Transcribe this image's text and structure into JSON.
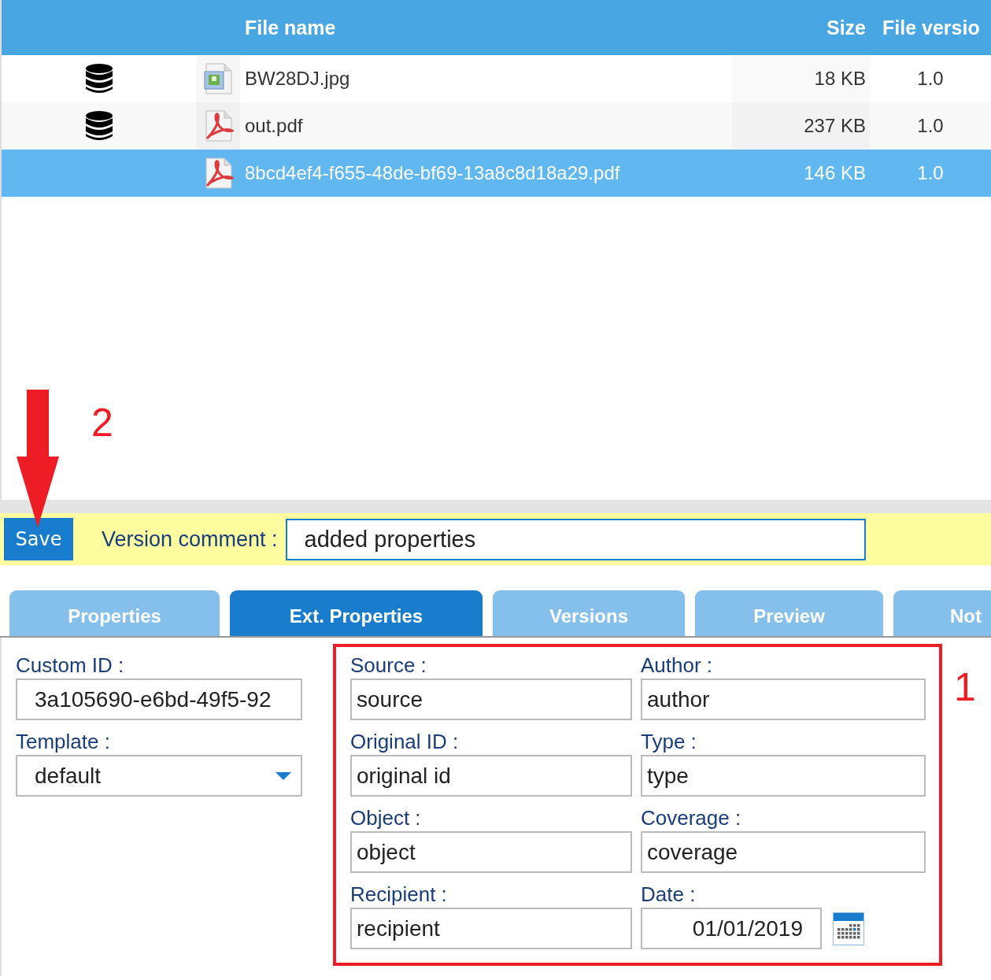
{
  "table": {
    "columns": [
      {
        "label": "File name"
      },
      {
        "label": "Size"
      },
      {
        "label": "File versio"
      }
    ],
    "rows": [
      {
        "stored": true,
        "kind": "image",
        "name": "BW28DJ.jpg",
        "size": "18 KB",
        "version": "1.0",
        "selected": false
      },
      {
        "stored": true,
        "kind": "pdf",
        "name": "out.pdf",
        "size": "237 KB",
        "version": "1.0",
        "selected": false
      },
      {
        "stored": false,
        "kind": "pdf",
        "name": "8bcd4ef4-f655-48de-bf69-13a8c8d18a29.pdf",
        "size": "146 KB",
        "version": "1.0",
        "selected": true
      }
    ]
  },
  "comment_bar": {
    "button": "Save",
    "label": "Version comment :",
    "value": "added properties"
  },
  "tabs": [
    {
      "label": "Properties",
      "selected": false
    },
    {
      "label": "Ext. Properties",
      "selected": true
    },
    {
      "label": "Versions",
      "selected": false
    },
    {
      "label": "Preview",
      "selected": false
    },
    {
      "label": "Not",
      "selected": false
    }
  ],
  "left_fields": [
    {
      "kind": "text",
      "label": "Custom ID :",
      "value": "3a105690-e6bd-49f5-92"
    },
    {
      "kind": "select",
      "label": "Template :",
      "value": "default"
    }
  ],
  "ext_fields": [
    {
      "kind": "text",
      "label": "Source :",
      "value": "source"
    },
    {
      "kind": "text",
      "label": "Author :",
      "value": "author"
    },
    {
      "kind": "text",
      "label": "Original ID :",
      "value": "original id"
    },
    {
      "kind": "text",
      "label": "Type :",
      "value": "type"
    },
    {
      "kind": "text",
      "label": "Object :",
      "value": "object"
    },
    {
      "kind": "text",
      "label": "Coverage :",
      "value": "coverage"
    },
    {
      "kind": "text",
      "label": "Recipient :",
      "value": "recipient"
    },
    {
      "kind": "date",
      "label": "Date :",
      "value": "01/01/2019"
    }
  ],
  "annotations": [
    {
      "kind": "box",
      "label": "1"
    },
    {
      "kind": "arrow",
      "label": "2"
    }
  ]
}
